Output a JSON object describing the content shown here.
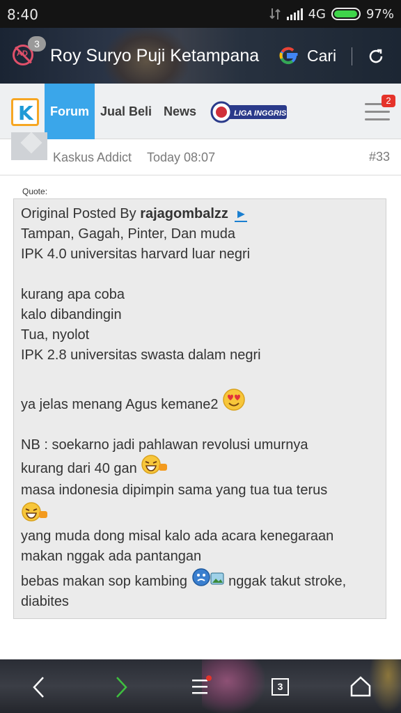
{
  "status_bar": {
    "time": "8:40",
    "network": "4G",
    "battery": "97%",
    "battery_level": 0.97
  },
  "browser": {
    "tab_count": "3",
    "page_title": "Roy Suryo Puji Ketampana",
    "search_label": "Cari",
    "tabs_button_count": "3"
  },
  "nav": {
    "forum": "Forum",
    "jual_beli": "Jual Beli",
    "news": "News",
    "liga": "LIGA INGGRIS",
    "menu_badge": "2"
  },
  "post": {
    "role": "Kaskus Addict",
    "time": "Today 08:07",
    "number": "#33"
  },
  "quote": {
    "label": "Quote:",
    "original_prefix": "Original Posted By",
    "author": "rajagombalzz",
    "link_glyph": "►",
    "lines": {
      "l1": "Tampan, Gagah, Pinter, Dan muda",
      "l2": "IPK 4.0 universitas harvard luar negri",
      "l3": "kurang apa coba",
      "l4": "kalo dibandingin",
      "l5": "Tua, nyolot",
      "l6": "IPK 2.8 universitas swasta dalam negri",
      "l7": "ya jelas menang Agus kemane2",
      "l8": "NB : soekarno jadi pahlawan revolusi umurnya",
      "l9": "kurang dari 40 gan",
      "l10": "masa indonesia dipimpin sama yang tua tua terus",
      "l11": "yang muda dong misal kalo ada acara kenegaraan",
      "l12": "makan nggak ada pantangan",
      "l13a": "bebas makan sop kambing",
      "l13b": "nggak takut stroke,",
      "l14": "diabites"
    }
  },
  "colors": {
    "forum_tab": "#3aa6ea",
    "link": "#1a7fd0",
    "badge_red": "#e5332a",
    "quote_bg": "#ebebeb"
  }
}
